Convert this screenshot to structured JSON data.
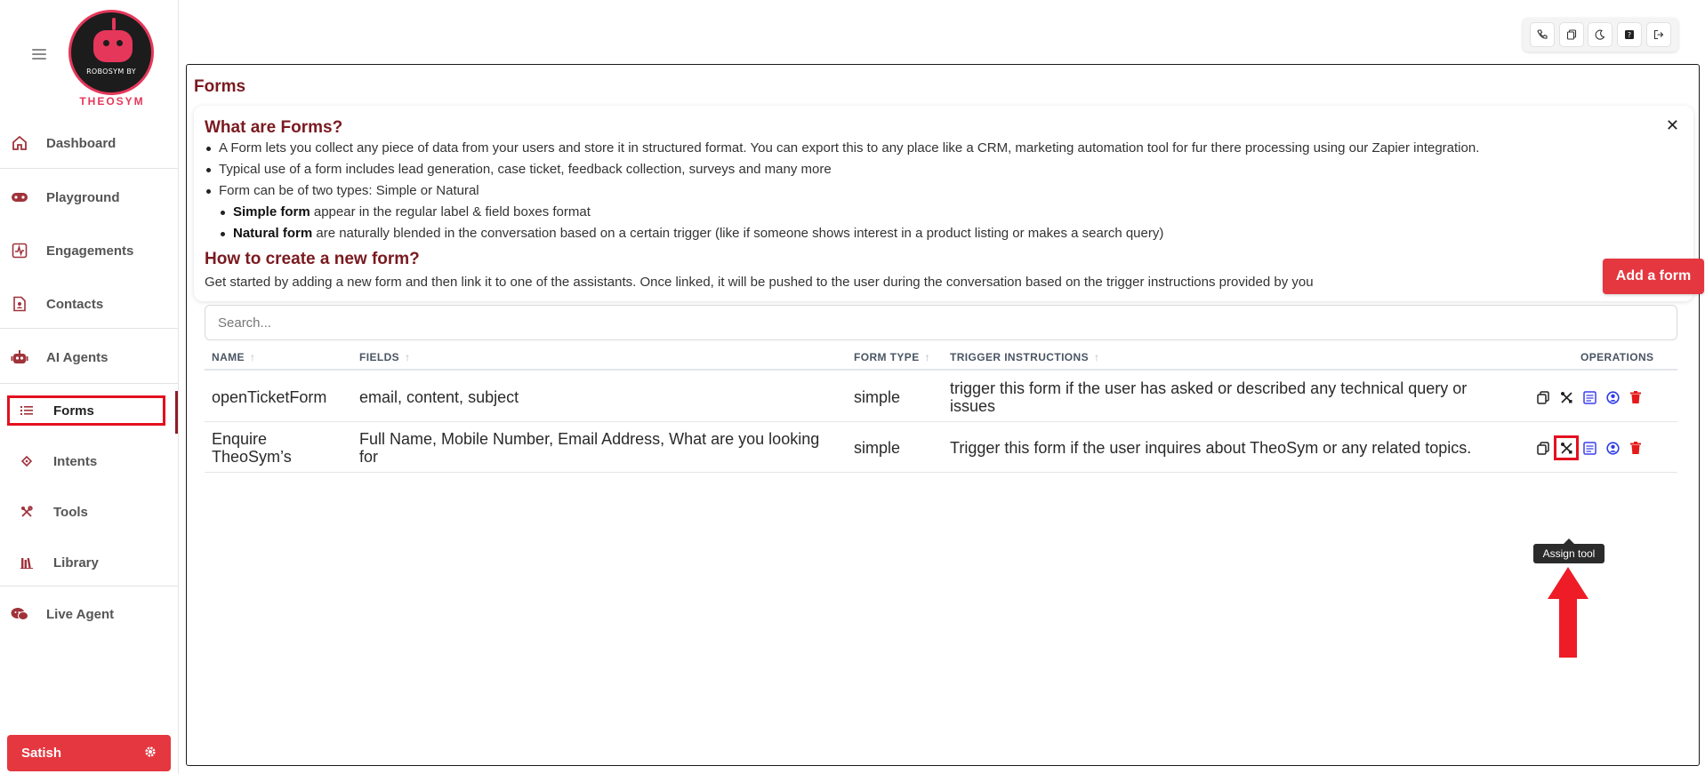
{
  "sidebar": {
    "logo_text": "ROBOSYM BY",
    "logo_brand": "THEOSYM",
    "items": [
      {
        "label": "Dashboard",
        "icon": "home-icon"
      },
      {
        "label": "Playground",
        "icon": "gamepad-icon"
      },
      {
        "label": "Engagements",
        "icon": "activity-icon"
      },
      {
        "label": "Contacts",
        "icon": "contact-file-icon"
      },
      {
        "label": "AI Agents",
        "icon": "robot-icon"
      },
      {
        "label": "Forms",
        "icon": "list-icon",
        "active": true
      },
      {
        "label": "Intents",
        "icon": "diamond-icon"
      },
      {
        "label": "Tools",
        "icon": "tools-icon"
      },
      {
        "label": "Library",
        "icon": "library-icon"
      },
      {
        "label": "Live Agent",
        "icon": "chat-icon"
      }
    ],
    "user": {
      "name": "Satish",
      "icon": "gear-icon"
    }
  },
  "toolbar": {
    "buttons": [
      "phone-icon",
      "copy-icon",
      "moon-icon",
      "help-icon",
      "logout-icon"
    ]
  },
  "main": {
    "title": "Forms",
    "info": {
      "heading1": "What are Forms?",
      "bullets": [
        "A Form lets you collect any piece of data from your users and store it in structured format. You can export this to any place like a CRM, marketing automation tool for fur there processing using our Zapier integration.",
        "Typical use of a form includes lead generation, case ticket, feedback collection, surveys and many more",
        "Form can be of two types: Simple or Natural"
      ],
      "sub_bullets": [
        {
          "bold": "Simple form",
          "rest": " appear in the regular label & field boxes format"
        },
        {
          "bold": "Natural form",
          "rest": " are naturally blended in the conversation based on a certain trigger (like if someone shows interest in a product listing or makes a search query)"
        }
      ],
      "heading2": "How to create a new form?",
      "paragraph": "Get started by adding a new form and then link it to one of the assistants. Once linked, it will be pushed to the user during the conversation based on the trigger instructions provided by you"
    },
    "add_button": "Add a form",
    "search_placeholder": "Search...",
    "table": {
      "headers": {
        "name": "NAME",
        "fields": "FIELDS",
        "form_type": "FORM TYPE",
        "trigger": "TRIGGER INSTRUCTIONS",
        "operations": "OPERATIONS"
      },
      "rows": [
        {
          "name": "openTicketForm",
          "fields": "email, content, subject",
          "form_type": "simple",
          "trigger": "trigger this form if the user has asked or described any technical query or issues"
        },
        {
          "name": "Enquire TheoSym’s",
          "fields": "Full Name, Mobile Number, Email Address, What are you looking for",
          "form_type": "simple",
          "trigger": "Trigger this form if the user inquires about TheoSym or any related topics."
        }
      ]
    },
    "tooltip": "Assign tool"
  },
  "colors": {
    "accent": "#e5373f",
    "title": "#7a1a20",
    "highlight": "#e3101f"
  }
}
